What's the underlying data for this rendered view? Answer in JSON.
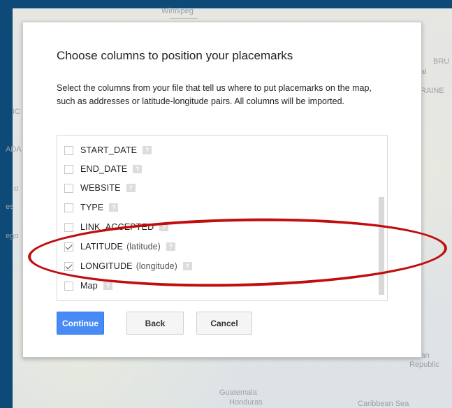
{
  "map": {
    "labels": {
      "winnipeg": "Winnipeg",
      "guatemala": "Guatemala",
      "honduras": "Honduras",
      "caribbean_sea": "Caribbean Sea",
      "dominican_republic_1": "inican",
      "dominican_republic_2": "Republic",
      "right_1": "al",
      "right_2": "BRU",
      "right_3": "RAINE",
      "left_1": "IC",
      "left_2": "ADA",
      "left_3": "es",
      "left_4": "ego",
      "left_5": "o"
    }
  },
  "dialog": {
    "title": "Choose columns to position your placemarks",
    "description": "Select the columns from your file that tell us where to put placemarks on the map, such as addresses or latitude-longitude pairs. All columns will be imported.",
    "help_glyph": "?",
    "columns": [
      {
        "name": "START_DATE",
        "suggestion": "",
        "checked": false
      },
      {
        "name": "END_DATE",
        "suggestion": "",
        "checked": false
      },
      {
        "name": "WEBSITE",
        "suggestion": "",
        "checked": false
      },
      {
        "name": "TYPE",
        "suggestion": "",
        "checked": false
      },
      {
        "name": "LINK_ACCEPTED",
        "suggestion": "",
        "checked": false
      },
      {
        "name": "LATITUDE",
        "suggestion": "(latitude)",
        "checked": true
      },
      {
        "name": "LONGITUDE",
        "suggestion": "(longitude)",
        "checked": true
      },
      {
        "name": "Map",
        "suggestion": "",
        "checked": false
      }
    ],
    "buttons": {
      "continue": "Continue",
      "back": "Back",
      "cancel": "Cancel"
    }
  },
  "colors": {
    "frame": "#0d4a78",
    "primary_button": "#4a8af4",
    "highlight_ellipse": "#c20d0d"
  }
}
